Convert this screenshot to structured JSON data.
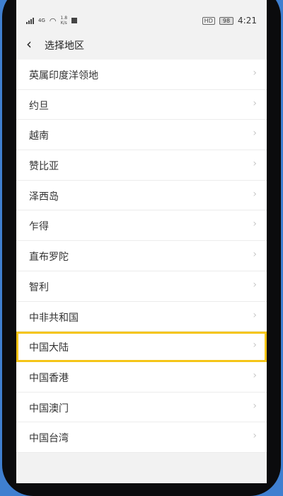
{
  "status": {
    "network": "4G",
    "speed_value": "1.8",
    "speed_unit": "K/s",
    "hd": "HD",
    "battery": "98",
    "time": "4:21"
  },
  "header": {
    "title": "选择地区"
  },
  "regions": [
    "英属印度洋领地",
    "约旦",
    "越南",
    "赞比亚",
    "泽西岛",
    "乍得",
    "直布罗陀",
    "智利",
    "中非共和国",
    "中国大陆",
    "中国香港",
    "中国澳门",
    "中国台湾"
  ],
  "highlighted_region": "中国大陆",
  "colors": {
    "frame": "#3f7fd0",
    "highlight": "#f5c518"
  }
}
